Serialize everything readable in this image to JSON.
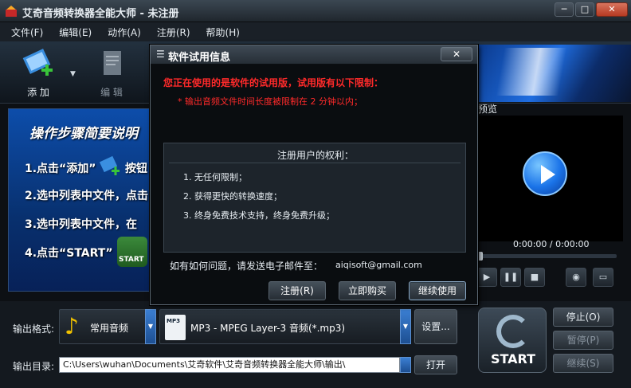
{
  "window": {
    "title": "艾奇音频转换器全能大师 - 未注册",
    "min": "─",
    "max": "□",
    "close": "✕"
  },
  "menu": [
    "文件(F)",
    "编辑(E)",
    "动作(A)",
    "注册(R)",
    "帮助(H)"
  ],
  "toolbar": {
    "add_label": "添 加",
    "edit_label": "编 辑",
    "dropdown": "▼"
  },
  "instructions": {
    "title": "操作步骤简要说明",
    "steps": [
      "1.点击“添加”",
      "按钮",
      "2.选中列表中文件，点击",
      "3.选中列表中文件，在",
      "4.点击“START”"
    ],
    "start_badge": "START"
  },
  "preview": {
    "label": "预览",
    "time": "0:00:00 / 0:00:00"
  },
  "output": {
    "format_label": "输出格式:",
    "format_category": "常用音频",
    "format_value": "MP3 - MPEG Layer-3 音频(*.mp3)",
    "format_icon_text": "MP3",
    "settings_button": "设置...",
    "dir_label": "输出目录:",
    "dir_value": "C:\\Users\\wuhan\\Documents\\艾奇软件\\艾奇音频转换器全能大师\\输出\\",
    "open_button": "打开"
  },
  "run": {
    "start_label": "START",
    "stop_label": "停止(O)",
    "pause_label": "暂停(P)",
    "continue_label": "继续(S)"
  },
  "dialog": {
    "title": "软件试用信息",
    "close": "✕",
    "warning": "您正在使用的是软件的试用版，试用版有以下限制：",
    "limit": "* 输出音频文件时间长度被限制在 2 分钟以内；",
    "rights_title": "注册用户的权利：",
    "rights": [
      "1. 无任何限制；",
      "2. 获得更快的转换速度；",
      "3. 终身免费技术支持，终身免费升级；"
    ],
    "contact": "如有如何问题，请发送电子邮件至：",
    "email": "aiqisoft@gmail.com",
    "buttons": {
      "register": "注册(R)",
      "buy": "立即购买",
      "continue": "继续使用"
    }
  }
}
